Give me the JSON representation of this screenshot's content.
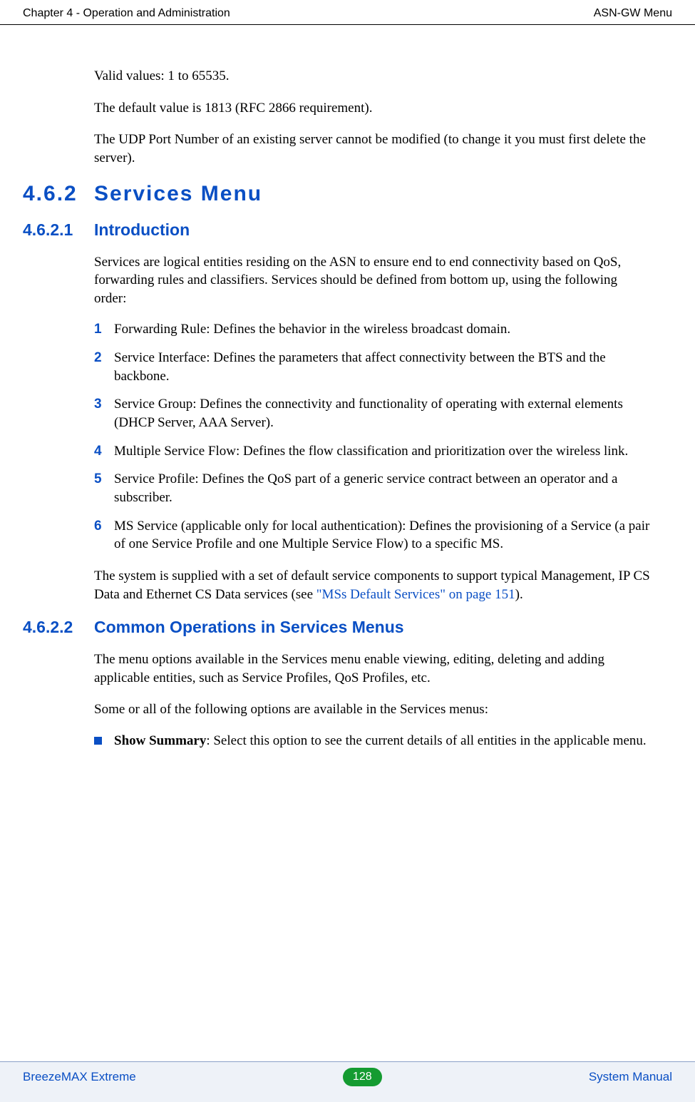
{
  "header": {
    "left": "Chapter 4 - Operation and Administration",
    "right": "ASN-GW Menu"
  },
  "intro_paragraphs": {
    "p1": "Valid values: 1 to 65535.",
    "p2": "The default value is 1813 (RFC 2866 requirement).",
    "p3": "The UDP Port Number of an existing server cannot be modified (to change it you must first delete the server)."
  },
  "section": {
    "num": "4.6.2",
    "title": "Services Menu"
  },
  "sub1": {
    "num": "4.6.2.1",
    "title": "Introduction",
    "intro": "Services are logical entities residing on the ASN to ensure end to end connectivity based on QoS, forwarding rules and classifiers. Services should be defined from bottom up, using the following order:",
    "items": [
      "Forwarding Rule: Defines the behavior in the wireless broadcast domain.",
      "Service Interface: Defines the parameters that affect connectivity between the BTS and the backbone.",
      "Service Group: Defines the connectivity and functionality of operating with external elements (DHCP Server, AAA Server).",
      "Multiple Service Flow: Defines the flow classification and prioritization over the wireless link.",
      "Service Profile: Defines the QoS part of a generic service contract between an operator and a subscriber.",
      "MS Service (applicable only for local authentication): Defines the provisioning of a Service (a pair of one Service Profile and one Multiple Service Flow) to a specific MS."
    ],
    "after_pre": "The system is supplied with a set of default service components to support typical Management, IP CS Data and Ethernet CS Data services (see ",
    "after_link": "\"MSs Default Services\" on page 151",
    "after_post": ")."
  },
  "sub2": {
    "num": "4.6.2.2",
    "title": "Common Operations in Services Menus",
    "p1": "The menu options available in the Services menu enable viewing, editing, deleting and adding applicable entities, such as Service Profiles, QoS Profiles, etc.",
    "p2": "Some or all of the following options are available in the Services menus:",
    "bullet_bold": "Show Summary",
    "bullet_rest": ": Select this option to see the current details of all entities in the applicable menu."
  },
  "footer": {
    "left": "BreezeMAX Extreme",
    "page": "128",
    "right": "System Manual"
  }
}
